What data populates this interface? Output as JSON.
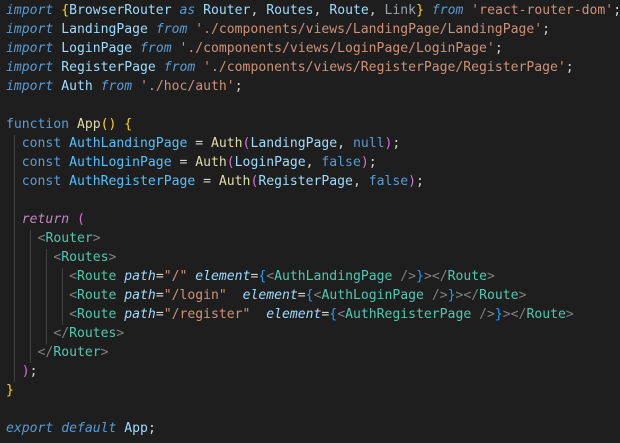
{
  "editor": {
    "lines": [
      [
        [
          "t-kwi",
          "import"
        ],
        [
          "t-plain",
          " "
        ],
        [
          "t-brace",
          "{"
        ],
        [
          "t-var",
          "BrowserRouter"
        ],
        [
          "t-plain",
          " "
        ],
        [
          "t-kwi",
          "as"
        ],
        [
          "t-plain",
          " "
        ],
        [
          "t-var",
          "Router"
        ],
        [
          "t-plain",
          ", "
        ],
        [
          "t-var",
          "Routes"
        ],
        [
          "t-plain",
          ", "
        ],
        [
          "t-var",
          "Route"
        ],
        [
          "t-plain",
          ", "
        ],
        [
          "t-dim",
          "Link"
        ],
        [
          "t-brace",
          "}"
        ],
        [
          "t-plain",
          " "
        ],
        [
          "t-kwi",
          "from"
        ],
        [
          "t-plain",
          " "
        ],
        [
          "t-str",
          "'react-router-dom'"
        ],
        [
          "t-plain",
          ";"
        ]
      ],
      [
        [
          "t-kwi",
          "import"
        ],
        [
          "t-plain",
          " "
        ],
        [
          "t-var",
          "LandingPage"
        ],
        [
          "t-plain",
          " "
        ],
        [
          "t-kwi",
          "from"
        ],
        [
          "t-plain",
          " "
        ],
        [
          "t-str",
          "'./components/views/LandingPage/LandingPage'"
        ],
        [
          "t-plain",
          ";"
        ]
      ],
      [
        [
          "t-kwi",
          "import"
        ],
        [
          "t-plain",
          " "
        ],
        [
          "t-var",
          "LoginPage"
        ],
        [
          "t-plain",
          " "
        ],
        [
          "t-kwi",
          "from"
        ],
        [
          "t-plain",
          " "
        ],
        [
          "t-str",
          "'./components/views/LoginPage/LoginPage'"
        ],
        [
          "t-plain",
          ";"
        ]
      ],
      [
        [
          "t-kwi",
          "import"
        ],
        [
          "t-plain",
          " "
        ],
        [
          "t-var",
          "RegisterPage"
        ],
        [
          "t-plain",
          " "
        ],
        [
          "t-kwi",
          "from"
        ],
        [
          "t-plain",
          " "
        ],
        [
          "t-str",
          "'./components/views/RegisterPage/RegisterPage'"
        ],
        [
          "t-plain",
          ";"
        ]
      ],
      [
        [
          "t-kwi",
          "import"
        ],
        [
          "t-plain",
          " "
        ],
        [
          "t-var",
          "Auth"
        ],
        [
          "t-plain",
          " "
        ],
        [
          "t-kwi",
          "from"
        ],
        [
          "t-plain",
          " "
        ],
        [
          "t-str",
          "'./hoc/auth'"
        ],
        [
          "t-plain",
          ";"
        ]
      ],
      [],
      [
        [
          "t-kw",
          "function"
        ],
        [
          "t-plain",
          " "
        ],
        [
          "t-fn",
          "App"
        ],
        [
          "t-brace",
          "()"
        ],
        [
          "t-plain",
          " "
        ],
        [
          "t-brace",
          "{"
        ]
      ],
      [
        [
          "t-plain",
          "  "
        ],
        [
          "t-kw",
          "const"
        ],
        [
          "t-plain",
          " "
        ],
        [
          "t-var2",
          "AuthLandingPage"
        ],
        [
          "t-plain",
          " = "
        ],
        [
          "t-fn",
          "Auth"
        ],
        [
          "t-brace2",
          "("
        ],
        [
          "t-var",
          "LandingPage"
        ],
        [
          "t-plain",
          ", "
        ],
        [
          "t-const",
          "null"
        ],
        [
          "t-brace2",
          ")"
        ],
        [
          "t-plain",
          ";"
        ]
      ],
      [
        [
          "t-plain",
          "  "
        ],
        [
          "t-kw",
          "const"
        ],
        [
          "t-plain",
          " "
        ],
        [
          "t-var2",
          "AuthLoginPage"
        ],
        [
          "t-plain",
          " = "
        ],
        [
          "t-fn",
          "Auth"
        ],
        [
          "t-brace2",
          "("
        ],
        [
          "t-var",
          "LoginPage"
        ],
        [
          "t-plain",
          ", "
        ],
        [
          "t-const",
          "false"
        ],
        [
          "t-brace2",
          ")"
        ],
        [
          "t-plain",
          ";"
        ]
      ],
      [
        [
          "t-plain",
          "  "
        ],
        [
          "t-kw",
          "const"
        ],
        [
          "t-plain",
          " "
        ],
        [
          "t-var2",
          "AuthRegisterPage"
        ],
        [
          "t-plain",
          " = "
        ],
        [
          "t-fn",
          "Auth"
        ],
        [
          "t-brace2",
          "("
        ],
        [
          "t-var",
          "RegisterPage"
        ],
        [
          "t-plain",
          ", "
        ],
        [
          "t-const",
          "false"
        ],
        [
          "t-brace2",
          ")"
        ],
        [
          "t-plain",
          ";"
        ]
      ],
      [],
      [
        [
          "t-plain",
          "  "
        ],
        [
          "t-ctrl",
          "return"
        ],
        [
          "t-plain",
          " "
        ],
        [
          "t-brace2",
          "("
        ]
      ],
      [
        [
          "t-plain",
          "    "
        ],
        [
          "t-tagp",
          "<"
        ],
        [
          "t-tag",
          "Router"
        ],
        [
          "t-tagp",
          ">"
        ]
      ],
      [
        [
          "t-plain",
          "      "
        ],
        [
          "t-tagp",
          "<"
        ],
        [
          "t-tag",
          "Routes"
        ],
        [
          "t-tagp",
          ">"
        ]
      ],
      [
        [
          "t-plain",
          "        "
        ],
        [
          "t-tagp",
          "<"
        ],
        [
          "t-tag",
          "Route"
        ],
        [
          "t-plain",
          " "
        ],
        [
          "t-attr",
          "path"
        ],
        [
          "t-plain",
          "="
        ],
        [
          "t-str",
          "\"/\""
        ],
        [
          "t-plain",
          " "
        ],
        [
          "t-attr",
          "element"
        ],
        [
          "t-plain",
          "="
        ],
        [
          "t-brace3",
          "{"
        ],
        [
          "t-tagp",
          "<"
        ],
        [
          "t-tag",
          "AuthLandingPage"
        ],
        [
          "t-plain",
          " "
        ],
        [
          "t-tagp",
          "/>"
        ],
        [
          "t-brace3",
          "}"
        ],
        [
          "t-tagp",
          "></"
        ],
        [
          "t-tag",
          "Route"
        ],
        [
          "t-tagp",
          ">"
        ]
      ],
      [
        [
          "t-plain",
          "        "
        ],
        [
          "t-tagp",
          "<"
        ],
        [
          "t-tag",
          "Route"
        ],
        [
          "t-plain",
          " "
        ],
        [
          "t-attr",
          "path"
        ],
        [
          "t-plain",
          "="
        ],
        [
          "t-str",
          "\"/login\""
        ],
        [
          "t-plain",
          "  "
        ],
        [
          "t-attr",
          "element"
        ],
        [
          "t-plain",
          "="
        ],
        [
          "t-brace3",
          "{"
        ],
        [
          "t-tagp",
          "<"
        ],
        [
          "t-tag",
          "AuthLoginPage"
        ],
        [
          "t-plain",
          " "
        ],
        [
          "t-tagp",
          "/>"
        ],
        [
          "t-brace3",
          "}"
        ],
        [
          "t-tagp",
          "></"
        ],
        [
          "t-tag",
          "Route"
        ],
        [
          "t-tagp",
          ">"
        ]
      ],
      [
        [
          "t-plain",
          "        "
        ],
        [
          "t-tagp",
          "<"
        ],
        [
          "t-tag",
          "Route"
        ],
        [
          "t-plain",
          " "
        ],
        [
          "t-attr",
          "path"
        ],
        [
          "t-plain",
          "="
        ],
        [
          "t-str",
          "\"/register\""
        ],
        [
          "t-plain",
          "  "
        ],
        [
          "t-attr",
          "element"
        ],
        [
          "t-plain",
          "="
        ],
        [
          "t-brace3",
          "{"
        ],
        [
          "t-tagp",
          "<"
        ],
        [
          "t-tag",
          "AuthRegisterPage"
        ],
        [
          "t-plain",
          " "
        ],
        [
          "t-tagp",
          "/>"
        ],
        [
          "t-brace3",
          "}"
        ],
        [
          "t-tagp",
          "></"
        ],
        [
          "t-tag",
          "Route"
        ],
        [
          "t-tagp",
          ">"
        ]
      ],
      [
        [
          "t-plain",
          "      "
        ],
        [
          "t-tagp",
          "</"
        ],
        [
          "t-tag",
          "Routes"
        ],
        [
          "t-tagp",
          ">"
        ]
      ],
      [
        [
          "t-plain",
          "    "
        ],
        [
          "t-tagp",
          "</"
        ],
        [
          "t-tag",
          "Router"
        ],
        [
          "t-tagp",
          ">"
        ]
      ],
      [
        [
          "t-plain",
          "  "
        ],
        [
          "t-brace2",
          ")"
        ],
        [
          "t-plain",
          ";"
        ]
      ],
      [
        [
          "t-brace",
          "}"
        ]
      ],
      [],
      [
        [
          "t-kwi",
          "export"
        ],
        [
          "t-plain",
          " "
        ],
        [
          "t-kwi",
          "default"
        ],
        [
          "t-plain",
          " "
        ],
        [
          "t-var",
          "App"
        ],
        [
          "t-plain",
          ";"
        ]
      ]
    ]
  }
}
